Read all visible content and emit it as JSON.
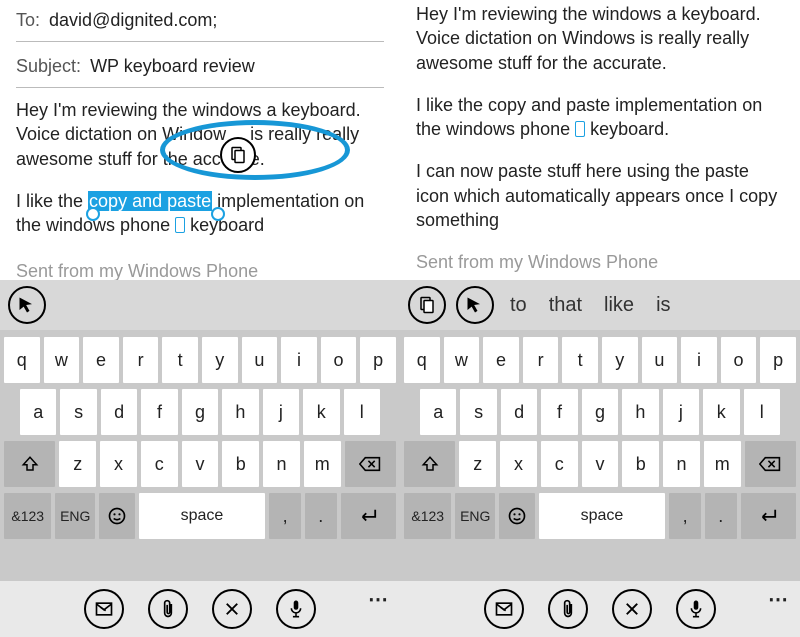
{
  "email": {
    "to_label": "To:",
    "to_value": "david@dignited.com;",
    "subject_label": "Subject:",
    "subject_value": "WP keyboard review",
    "para1": "Hey I'm reviewing the windows a keyboard. Voice dictation on Windows is really really awesome stuff for the accurate.",
    "para1_left_part_a": "Hey I'm reviewing the windows a keyboard. Voice dictation on Window",
    "para1_left_part_b": "is really really awesome stuff for the acc",
    "para1_left_part_c": "te.",
    "para2_a": "I like the ",
    "para2_highlight": "copy and paste",
    "para2_b": " implementation on the windows phone ",
    "para2_c": " keyboard",
    "para2_c_right": " keyboard.",
    "para3_right": "I can now paste stuff here using the paste icon which automatically appears once I copy something",
    "signature": "Sent from my Windows Phone"
  },
  "suggestions": {
    "right_words": [
      "to",
      "that",
      "like",
      "is"
    ]
  },
  "keyboard": {
    "row1": [
      "q",
      "w",
      "e",
      "r",
      "t",
      "y",
      "u",
      "i",
      "o",
      "p"
    ],
    "row2": [
      "a",
      "s",
      "d",
      "f",
      "g",
      "h",
      "j",
      "k",
      "l"
    ],
    "row3_letters": [
      "z",
      "x",
      "c",
      "v",
      "b",
      "n",
      "m"
    ],
    "sym": "&123",
    "eng": "ENG",
    "space": "space",
    "period": ".",
    "comma": ","
  },
  "icons": {
    "copy": "copy-icon",
    "cursor": "cursor-icon",
    "paste": "paste-icon",
    "shift": "shift-icon",
    "backspace": "backspace-icon",
    "emoji": "emoji-icon",
    "enter": "enter-icon",
    "send": "send-icon",
    "attach": "attach-icon",
    "close": "close-icon",
    "mic": "mic-icon",
    "more": "more-icon"
  },
  "appbar_dots": "⋯"
}
